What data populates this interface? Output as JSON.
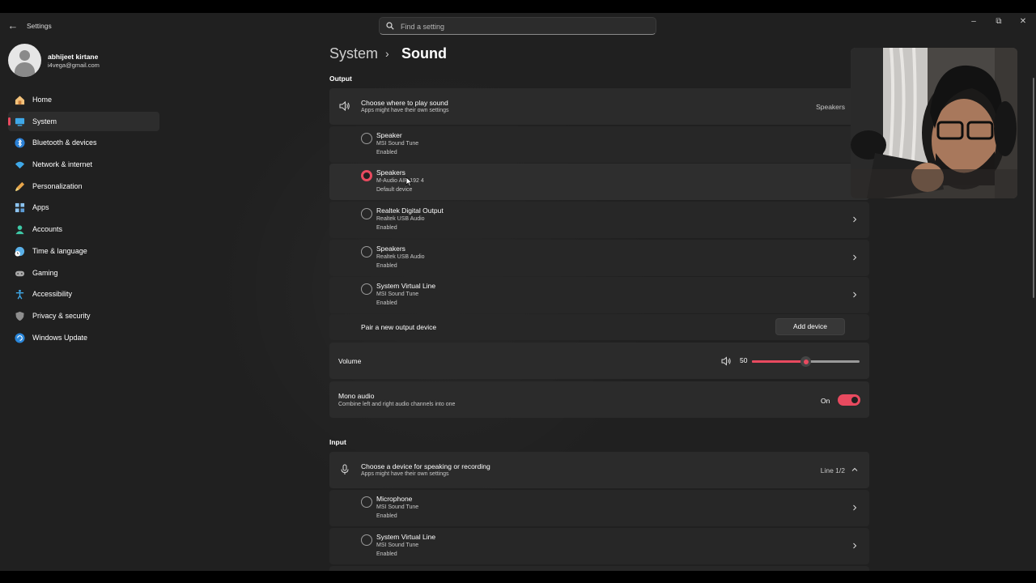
{
  "window": {
    "title": "Settings",
    "search_placeholder": "Find a setting"
  },
  "user": {
    "name": "abhijeet kirtane",
    "email": "i4vega@gmail.com"
  },
  "nav": [
    {
      "label": "Home",
      "icon": "home-icon",
      "active": false
    },
    {
      "label": "System",
      "icon": "system-icon",
      "active": true
    },
    {
      "label": "Bluetooth & devices",
      "icon": "bluetooth-icon",
      "active": false
    },
    {
      "label": "Network & internet",
      "icon": "wifi-icon",
      "active": false
    },
    {
      "label": "Personalization",
      "icon": "brush-icon",
      "active": false
    },
    {
      "label": "Apps",
      "icon": "apps-icon",
      "active": false
    },
    {
      "label": "Accounts",
      "icon": "accounts-icon",
      "active": false
    },
    {
      "label": "Time & language",
      "icon": "globe-clock-icon",
      "active": false
    },
    {
      "label": "Gaming",
      "icon": "gamepad-icon",
      "active": false
    },
    {
      "label": "Accessibility",
      "icon": "accessibility-icon",
      "active": false
    },
    {
      "label": "Privacy & security",
      "icon": "shield-icon",
      "active": false
    },
    {
      "label": "Windows Update",
      "icon": "update-icon",
      "active": false
    }
  ],
  "breadcrumb": {
    "parent": "System",
    "separator": "›",
    "current": "Sound"
  },
  "output": {
    "section_label": "Output",
    "header": {
      "title": "Choose where to play sound",
      "subtitle": "Apps might have their own settings",
      "value": "Speakers"
    },
    "devices": [
      {
        "name": "Speaker",
        "driver": "MSI Sound Tune",
        "status": "Enabled",
        "selected": false,
        "has_chevron": false
      },
      {
        "name": "Speakers",
        "driver": "M-Audio AIR 192 4",
        "status": "Default device",
        "selected": true,
        "has_chevron": false
      },
      {
        "name": "Realtek Digital Output",
        "driver": "Realtek USB Audio",
        "status": "Enabled",
        "selected": false,
        "has_chevron": true
      },
      {
        "name": "Speakers",
        "driver": "Realtek USB Audio",
        "status": "Enabled",
        "selected": false,
        "has_chevron": true
      },
      {
        "name": "System Virtual Line",
        "driver": "MSI Sound Tune",
        "status": "Enabled",
        "selected": false,
        "has_chevron": true
      }
    ],
    "pair": {
      "label": "Pair a new output device",
      "button": "Add device"
    },
    "volume": {
      "label": "Volume",
      "value": "50",
      "fraction": 0.5
    },
    "mono": {
      "title": "Mono audio",
      "subtitle": "Combine left and right audio channels into one",
      "state": "On"
    }
  },
  "input": {
    "section_label": "Input",
    "header": {
      "title": "Choose a device for speaking or recording",
      "subtitle": "Apps might have their own settings",
      "value": "Line 1/2"
    },
    "devices": [
      {
        "name": "Microphone",
        "driver": "MSI Sound Tune",
        "status": "Enabled",
        "selected": false,
        "has_chevron": true
      },
      {
        "name": "System Virtual Line",
        "driver": "MSI Sound Tune",
        "status": "Enabled",
        "selected": false,
        "has_chevron": true
      }
    ]
  },
  "colors": {
    "accent": "#e84a5f",
    "background": "#202020",
    "card": "#2b2b2b"
  }
}
